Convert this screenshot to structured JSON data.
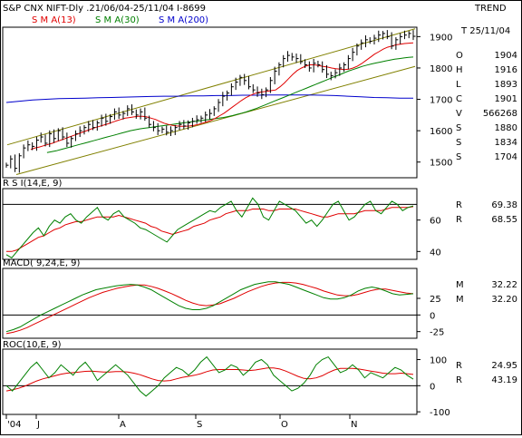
{
  "header": {
    "title": "S&P CNX NIFT-Dly .21/06/04-25/11/04  I-8699",
    "trend": "TREND",
    "sma13": "S M A(13)",
    "sma30": "S M A(30)",
    "sma200": "S M A(200)",
    "date_label": "T 25/11/04"
  },
  "colors": {
    "green": "#008000",
    "red": "#e00000",
    "blue": "#0000cc",
    "olive": "#808000",
    "gray": "#808080"
  },
  "readouts": {
    "price": [
      {
        "k": "O",
        "v": "1904",
        "color": "#000000"
      },
      {
        "k": "H",
        "v": "1916",
        "color": "#808000"
      },
      {
        "k": "L",
        "v": "1893",
        "color": "#808000"
      },
      {
        "k": "C",
        "v": "1901",
        "color": "#808000"
      },
      {
        "k": "V",
        "v": "566268",
        "color": "#000000"
      },
      {
        "k": "S",
        "v": "1880",
        "color": "#e00000"
      },
      {
        "k": "S",
        "v": "1834",
        "color": "#008000"
      },
      {
        "k": "S",
        "v": "1704",
        "color": "#0000cc"
      }
    ],
    "rsi": [
      {
        "k": "R",
        "v": "69.38",
        "color": "#008000"
      },
      {
        "k": "R",
        "v": "68.55",
        "color": "#e00000"
      }
    ],
    "macd": [
      {
        "k": "M",
        "v": "32.22",
        "color": "#008000"
      },
      {
        "k": "M",
        "v": "32.20",
        "color": "#e00000"
      }
    ],
    "roc": [
      {
        "k": "R",
        "v": "24.95",
        "color": "#008000"
      },
      {
        "k": "R",
        "v": "43.19",
        "color": "#e00000"
      }
    ]
  },
  "panels": {
    "rsi_title": "R S I(14,E, 9)",
    "macd_title": "MACD( 9,24,E, 9)",
    "roc_title": "ROC(10,E, 9)"
  },
  "chart_data": [
    {
      "type": "line",
      "name": "price",
      "x_ticks": [
        "'04",
        "J",
        "A",
        "S",
        "O",
        "N"
      ],
      "y_ticks": [
        "1500",
        "1600",
        "1700",
        "1800",
        "1900"
      ],
      "ylim": [
        1450,
        1930
      ],
      "close": [
        1490,
        1510,
        1480,
        1520,
        1545,
        1555,
        1550,
        1570,
        1580,
        1560,
        1590,
        1575,
        1600,
        1580,
        1560,
        1575,
        1590,
        1600,
        1610,
        1620,
        1610,
        1625,
        1640,
        1630,
        1645,
        1660,
        1650,
        1655,
        1670,
        1660,
        1650,
        1660,
        1640,
        1620,
        1610,
        1600,
        1605,
        1595,
        1600,
        1610,
        1620,
        1615,
        1625,
        1630,
        1635,
        1640,
        1650,
        1655,
        1670,
        1690,
        1710,
        1720,
        1740,
        1755,
        1770,
        1760,
        1740,
        1730,
        1720,
        1715,
        1730,
        1760,
        1790,
        1810,
        1830,
        1840,
        1835,
        1830,
        1820,
        1810,
        1800,
        1815,
        1810,
        1795,
        1780,
        1775,
        1785,
        1800,
        1810,
        1830,
        1850,
        1870,
        1880,
        1890,
        1885,
        1895,
        1905,
        1910,
        1900,
        1870,
        1890,
        1900,
        1905,
        1910,
        1901
      ],
      "sma13": [
        1540,
        1545,
        1548,
        1552,
        1556,
        1560,
        1565,
        1570,
        1575,
        1580,
        1585,
        1590,
        1595,
        1600,
        1605,
        1610,
        1614,
        1618,
        1622,
        1627,
        1632,
        1636,
        1640,
        1642,
        1644,
        1646,
        1646,
        1644,
        1640,
        1636,
        1630,
        1624,
        1620,
        1617,
        1615,
        1614,
        1614,
        1615,
        1617,
        1620,
        1624,
        1628,
        1633,
        1640,
        1648,
        1656,
        1666,
        1676,
        1686,
        1696,
        1705,
        1712,
        1718,
        1722,
        1724,
        1726,
        1728,
        1730,
        1740,
        1752,
        1766,
        1780,
        1792,
        1800,
        1806,
        1810,
        1810,
        1808,
        1805,
        1803,
        1800,
        1798,
        1796,
        1795,
        1796,
        1800,
        1806,
        1814,
        1824,
        1834,
        1844,
        1852,
        1860,
        1866,
        1870,
        1874,
        1876,
        1878,
        1879,
        1880
      ],
      "sma30": [
        1530,
        1533,
        1536,
        1540,
        1544,
        1548,
        1552,
        1556,
        1560,
        1564,
        1568,
        1572,
        1576,
        1580,
        1584,
        1588,
        1592,
        1596,
        1600,
        1603,
        1606,
        1608,
        1610,
        1612,
        1614,
        1616,
        1618,
        1620,
        1622,
        1624,
        1626,
        1628,
        1630,
        1632,
        1634,
        1636,
        1638,
        1640,
        1642,
        1645,
        1648,
        1652,
        1656,
        1660,
        1665,
        1670,
        1676,
        1682,
        1688,
        1694,
        1700,
        1706,
        1712,
        1718,
        1724,
        1730,
        1736,
        1742,
        1748,
        1754,
        1760,
        1766,
        1772,
        1778,
        1784,
        1790,
        1795,
        1800,
        1805,
        1809,
        1813,
        1816,
        1819,
        1822,
        1825,
        1828,
        1830,
        1832,
        1834,
        1835
      ],
      "sma200": [
        1690,
        1694,
        1698,
        1700,
        1702,
        1703,
        1704,
        1705,
        1706,
        1707,
        1708,
        1709,
        1710,
        1710,
        1711,
        1711,
        1712,
        1712,
        1713,
        1713,
        1714,
        1714,
        1714,
        1714,
        1713,
        1712,
        1710,
        1708,
        1706,
        1705,
        1704,
        1704
      ]
    },
    {
      "type": "line",
      "name": "rsi",
      "y_ticks": [
        "40",
        "60"
      ],
      "ylim": [
        35,
        80
      ],
      "level": 70,
      "series": [
        {
          "values": [
            38,
            36,
            40,
            44,
            48,
            52,
            55,
            50,
            56,
            60,
            58,
            62,
            64,
            60,
            58,
            62,
            65,
            68,
            62,
            60,
            64,
            66,
            62,
            60,
            58,
            55,
            54,
            52,
            50,
            48,
            46,
            50,
            54,
            56,
            58,
            60,
            62,
            64,
            66,
            65,
            68,
            70,
            72,
            66,
            62,
            68,
            74,
            70,
            62,
            60,
            66,
            72,
            70,
            68,
            66,
            62,
            58,
            60,
            56,
            60,
            65,
            70,
            72,
            66,
            60,
            62,
            66,
            70,
            72,
            66,
            64,
            68,
            72,
            70,
            66,
            68,
            69
          ]
        },
        {
          "values": [
            40,
            40,
            41,
            43,
            45,
            47,
            49,
            50,
            52,
            54,
            55,
            57,
            58,
            59,
            59,
            60,
            61,
            62,
            62,
            62,
            62,
            63,
            62,
            61,
            60,
            59,
            58,
            56,
            55,
            53,
            52,
            51,
            52,
            53,
            54,
            56,
            57,
            58,
            60,
            61,
            62,
            64,
            65,
            66,
            66,
            66,
            67,
            67,
            67,
            66,
            66,
            67,
            67,
            67,
            67,
            66,
            65,
            64,
            63,
            62,
            62,
            63,
            64,
            64,
            64,
            64,
            65,
            66,
            66,
            66,
            66,
            67,
            68,
            68,
            68,
            68,
            68.5
          ]
        }
      ]
    },
    {
      "type": "line",
      "name": "macd",
      "y_ticks": [
        "25",
        "0",
        "-25"
      ],
      "ylim": [
        -35,
        70
      ],
      "level": 0,
      "series": [
        {
          "values": [
            -25,
            -22,
            -18,
            -12,
            -6,
            0,
            5,
            10,
            15,
            20,
            25,
            30,
            34,
            38,
            40,
            42,
            44,
            45,
            46,
            45,
            42,
            38,
            32,
            26,
            20,
            14,
            10,
            8,
            8,
            10,
            14,
            20,
            26,
            32,
            38,
            42,
            46,
            48,
            50,
            50,
            48,
            46,
            42,
            38,
            34,
            30,
            26,
            24,
            24,
            26,
            30,
            36,
            40,
            42,
            40,
            36,
            32,
            30,
            31,
            32
          ]
        },
        {
          "values": [
            -28,
            -26,
            -23,
            -19,
            -14,
            -9,
            -4,
            1,
            6,
            11,
            16,
            21,
            26,
            30,
            34,
            37,
            40,
            42,
            44,
            45,
            45,
            43,
            40,
            36,
            32,
            27,
            22,
            18,
            15,
            14,
            15,
            17,
            21,
            25,
            30,
            35,
            39,
            43,
            46,
            48,
            49,
            49,
            48,
            46,
            43,
            40,
            36,
            33,
            30,
            29,
            29,
            31,
            34,
            37,
            39,
            39,
            37,
            35,
            33,
            32
          ]
        }
      ]
    },
    {
      "type": "line",
      "name": "roc",
      "y_ticks": [
        "100",
        "0",
        "-100"
      ],
      "ylim": [
        -110,
        140
      ],
      "level": 0,
      "series": [
        {
          "values": [
            0,
            -20,
            10,
            40,
            70,
            90,
            60,
            30,
            50,
            80,
            60,
            40,
            70,
            90,
            60,
            20,
            40,
            60,
            80,
            60,
            40,
            10,
            -20,
            -40,
            -20,
            0,
            30,
            50,
            70,
            60,
            40,
            60,
            90,
            110,
            80,
            50,
            60,
            80,
            70,
            40,
            60,
            90,
            100,
            80,
            40,
            20,
            0,
            -20,
            -10,
            10,
            40,
            80,
            100,
            110,
            80,
            50,
            60,
            80,
            60,
            30,
            50,
            40,
            30,
            50,
            70,
            60,
            40,
            25
          ]
        },
        {
          "values": [
            -20,
            -16,
            -10,
            -2,
            8,
            18,
            26,
            32,
            38,
            44,
            48,
            50,
            52,
            55,
            56,
            54,
            52,
            52,
            54,
            54,
            52,
            48,
            42,
            34,
            26,
            20,
            18,
            20,
            26,
            32,
            36,
            40,
            46,
            54,
            60,
            62,
            62,
            62,
            62,
            60,
            58,
            60,
            64,
            68,
            68,
            64,
            56,
            46,
            36,
            28,
            26,
            30,
            38,
            50,
            60,
            66,
            66,
            66,
            64,
            60,
            56,
            52,
            48,
            46,
            46,
            48,
            46,
            43
          ]
        }
      ]
    }
  ]
}
